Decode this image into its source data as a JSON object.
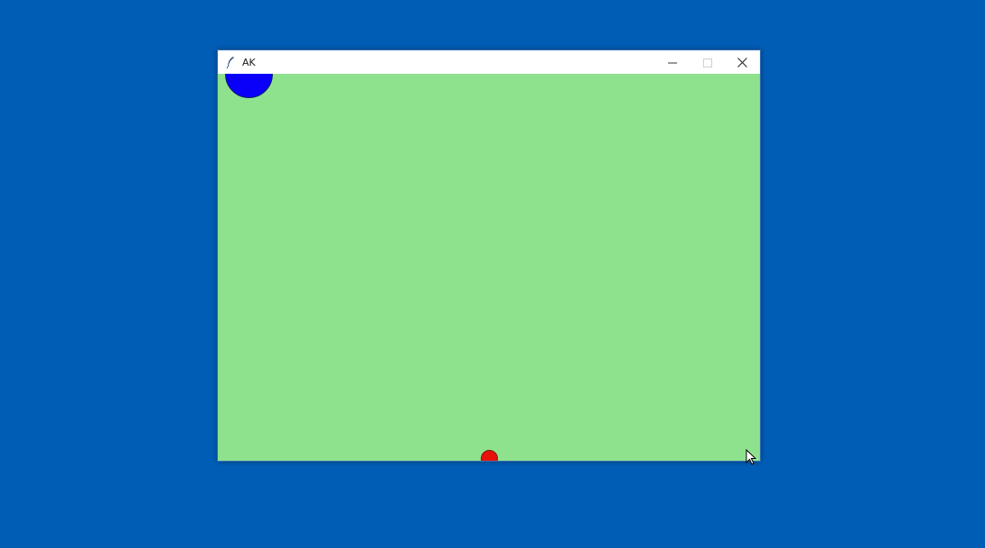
{
  "window": {
    "title": "AK",
    "controls": {
      "minimize_icon": "minimize-icon",
      "maximize_icon": "maximize-icon",
      "close_icon": "close-icon"
    }
  },
  "canvas": {
    "background": "#8ee28e",
    "objects": [
      {
        "name": "blue-ball",
        "color": "#0a00fa"
      },
      {
        "name": "red-ball",
        "color": "#e8120c"
      }
    ]
  },
  "desktop": {
    "background": "#005db6"
  }
}
